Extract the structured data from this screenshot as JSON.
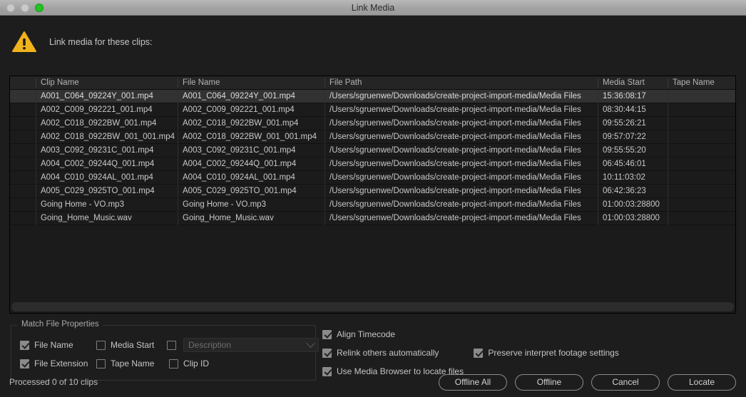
{
  "window": {
    "title": "Link Media",
    "controls": [
      {
        "name": "close-button",
        "color": "#c9c9c9"
      },
      {
        "name": "minimize-button",
        "color": "#c9c9c9"
      },
      {
        "name": "zoom-button",
        "color": "#22c322"
      }
    ]
  },
  "header": {
    "icon": "warning-triangle-icon",
    "message": "Link media for these clips:"
  },
  "table": {
    "columns": [
      "Clip Name",
      "File Name",
      "File Path",
      "Media Start",
      "Tape Name"
    ],
    "rows": [
      {
        "clip_name": "A001_C064_09224Y_001.mp4",
        "file_name": "A001_C064_09224Y_001.mp4",
        "file_path": "/Users/sgruenwe/Downloads/create-project-import-media/Media Files",
        "media_start": "15:36:08:17",
        "tape_name": "",
        "selected": true
      },
      {
        "clip_name": "A002_C009_092221_001.mp4",
        "file_name": "A002_C009_092221_001.mp4",
        "file_path": "/Users/sgruenwe/Downloads/create-project-import-media/Media Files",
        "media_start": "08:30:44:15",
        "tape_name": "",
        "selected": false
      },
      {
        "clip_name": "A002_C018_0922BW_001.mp4",
        "file_name": "A002_C018_0922BW_001.mp4",
        "file_path": "/Users/sgruenwe/Downloads/create-project-import-media/Media Files",
        "media_start": "09:55:26:21",
        "tape_name": "",
        "selected": false
      },
      {
        "clip_name": "A002_C018_0922BW_001_001.mp4",
        "file_name": "A002_C018_0922BW_001_001.mp4",
        "file_path": "/Users/sgruenwe/Downloads/create-project-import-media/Media Files",
        "media_start": "09:57:07:22",
        "tape_name": "",
        "selected": false
      },
      {
        "clip_name": "A003_C092_09231C_001.mp4",
        "file_name": "A003_C092_09231C_001.mp4",
        "file_path": "/Users/sgruenwe/Downloads/create-project-import-media/Media Files",
        "media_start": "09:55:55:20",
        "tape_name": "",
        "selected": false
      },
      {
        "clip_name": "A004_C002_09244Q_001.mp4",
        "file_name": "A004_C002_09244Q_001.mp4",
        "file_path": "/Users/sgruenwe/Downloads/create-project-import-media/Media Files",
        "media_start": "06:45:46:01",
        "tape_name": "",
        "selected": false
      },
      {
        "clip_name": "A004_C010_0924AL_001.mp4",
        "file_name": "A004_C010_0924AL_001.mp4",
        "file_path": "/Users/sgruenwe/Downloads/create-project-import-media/Media Files",
        "media_start": "10:11:03:02",
        "tape_name": "",
        "selected": false
      },
      {
        "clip_name": "A005_C029_0925TO_001.mp4",
        "file_name": "A005_C029_0925TO_001.mp4",
        "file_path": "/Users/sgruenwe/Downloads/create-project-import-media/Media Files",
        "media_start": "06:42:36:23",
        "tape_name": "",
        "selected": false
      },
      {
        "clip_name": "Going Home - VO.mp3",
        "file_name": "Going Home - VO.mp3",
        "file_path": "/Users/sgruenwe/Downloads/create-project-import-media/Media Files",
        "media_start": "01:00:03:28800",
        "tape_name": "",
        "selected": false
      },
      {
        "clip_name": "Going_Home_Music.wav",
        "file_name": "Going_Home_Music.wav",
        "file_path": "/Users/sgruenwe/Downloads/create-project-import-media/Media Files",
        "media_start": "01:00:03:28800",
        "tape_name": "",
        "selected": false
      }
    ]
  },
  "match_file_properties": {
    "title": "Match File Properties",
    "options": [
      {
        "label": "File Name",
        "checked": true,
        "disabled": false
      },
      {
        "label": "Media Start",
        "checked": false,
        "disabled": false
      },
      {
        "label": "File Extension",
        "checked": true,
        "disabled": false
      },
      {
        "label": "Tape Name",
        "checked": false,
        "disabled": false
      },
      {
        "label": "Clip ID",
        "checked": false,
        "disabled": false
      }
    ],
    "description_select": {
      "checked": false,
      "value": "Description",
      "disabled": true
    }
  },
  "link_options": [
    {
      "label": "Align Timecode",
      "checked": true
    },
    {
      "label": "Relink others automatically",
      "checked": true
    },
    {
      "label": "Preserve interpret footage settings",
      "checked": true
    },
    {
      "label": "Use Media Browser to locate files",
      "checked": true
    }
  ],
  "footer": {
    "status": "Processed 0 of 10 clips",
    "buttons": [
      {
        "label": "Offline All",
        "name": "offline-all-button"
      },
      {
        "label": "Offline",
        "name": "offline-button"
      },
      {
        "label": "Cancel",
        "name": "cancel-button"
      },
      {
        "label": "Locate",
        "name": "locate-button"
      }
    ]
  }
}
